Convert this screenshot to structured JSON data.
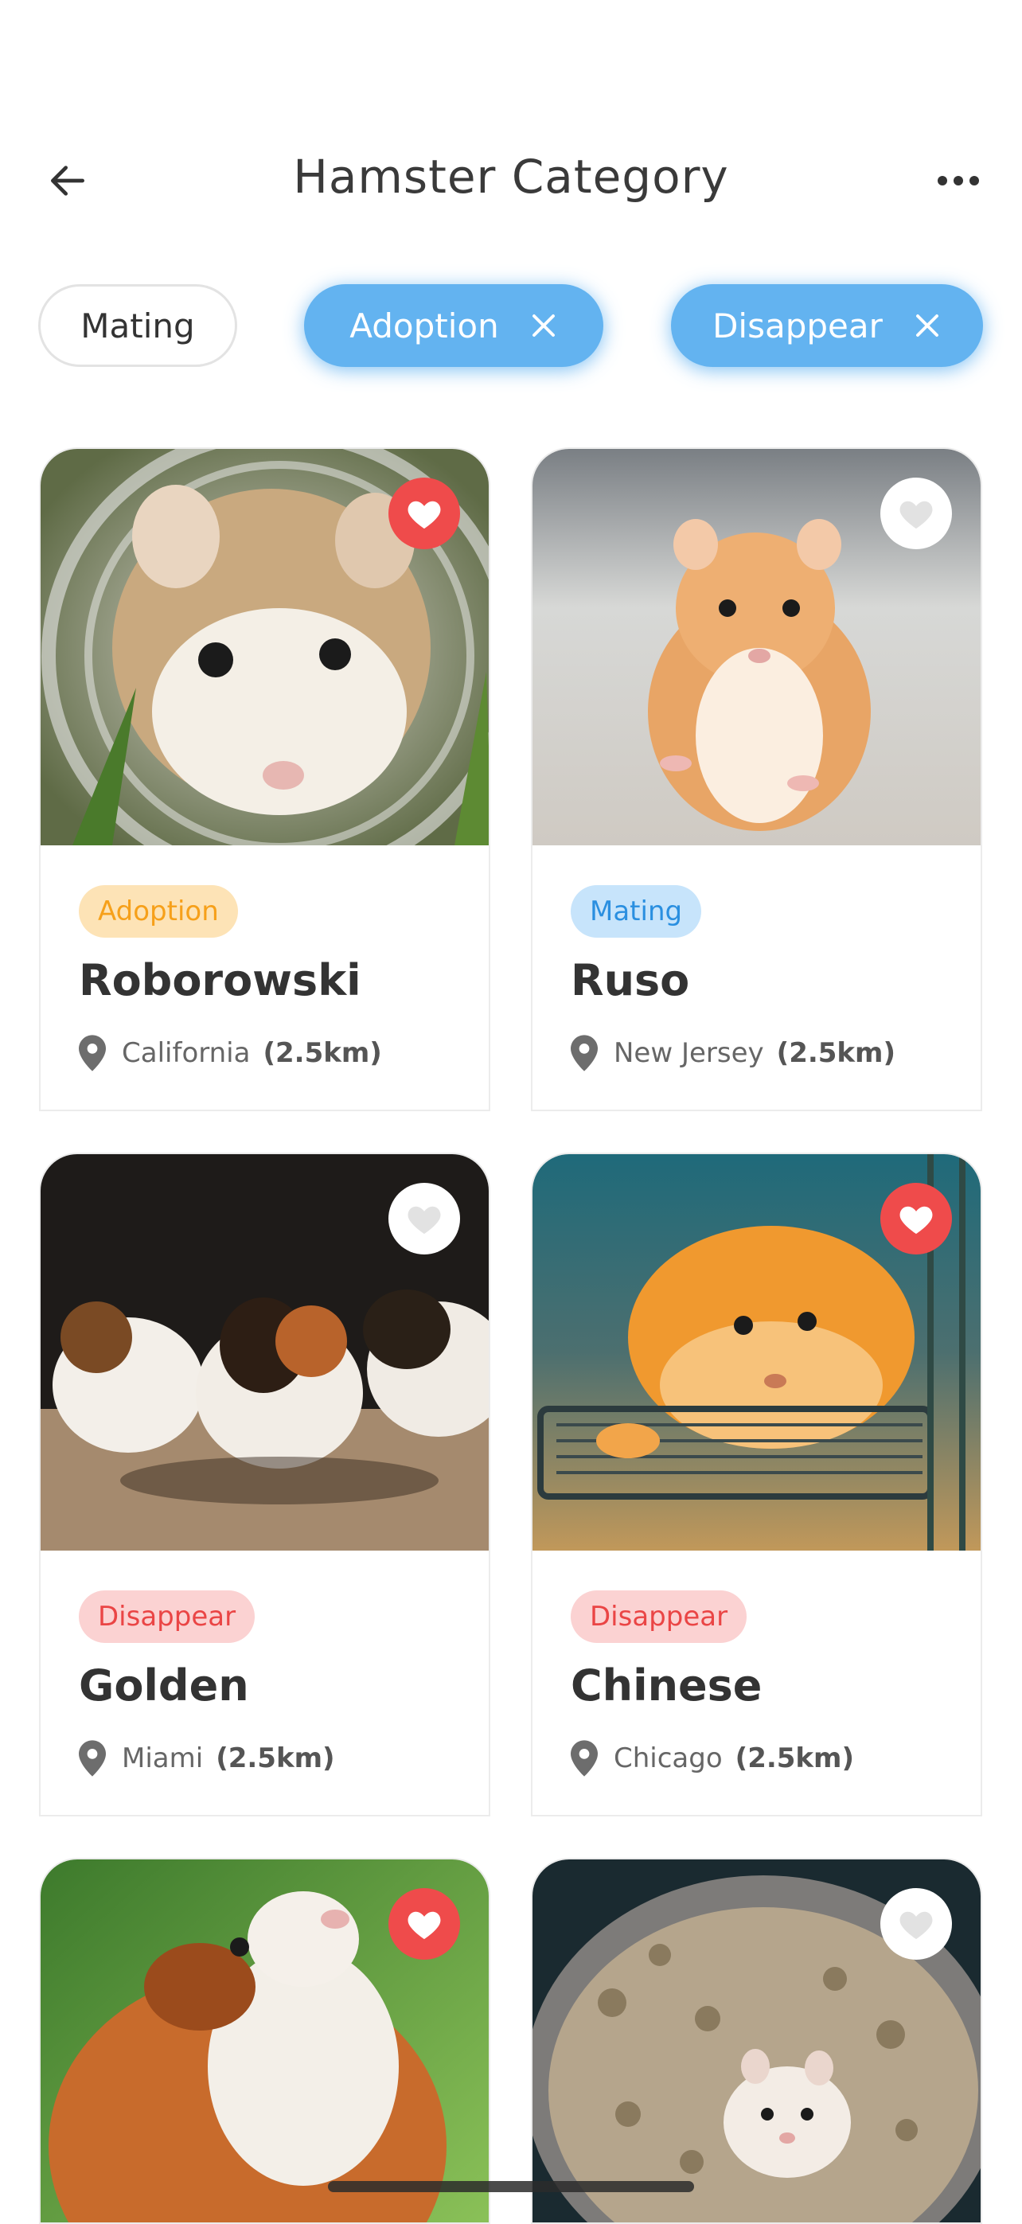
{
  "header": {
    "title": "Hamster Category"
  },
  "filters": [
    {
      "label": "Mating",
      "active": false
    },
    {
      "label": "Adoption",
      "active": true
    },
    {
      "label": "Disappear",
      "active": true
    }
  ],
  "cards": [
    {
      "tag": "Adoption",
      "name": "Roborowski",
      "location": "California",
      "distance": "(2.5km)",
      "favorite": true
    },
    {
      "tag": "Mating",
      "name": "Ruso",
      "location": "New Jersey",
      "distance": "(2.5km)",
      "favorite": false
    },
    {
      "tag": "Disappear",
      "name": "Golden",
      "location": "Miami",
      "distance": "(2.5km)",
      "favorite": false
    },
    {
      "tag": "Disappear",
      "name": "Chinese",
      "location": "Chicago",
      "distance": "(2.5km)",
      "favorite": true
    },
    {
      "tag": "",
      "name": "",
      "location": "",
      "distance": "",
      "favorite": true
    },
    {
      "tag": "",
      "name": "",
      "location": "",
      "distance": "",
      "favorite": false
    }
  ],
  "colors": {
    "accent": "#63b3f0",
    "favorite": "#ef4b4b",
    "adoption": "#f6a01a",
    "mating": "#2a8fe0",
    "disappear": "#ea4545"
  }
}
